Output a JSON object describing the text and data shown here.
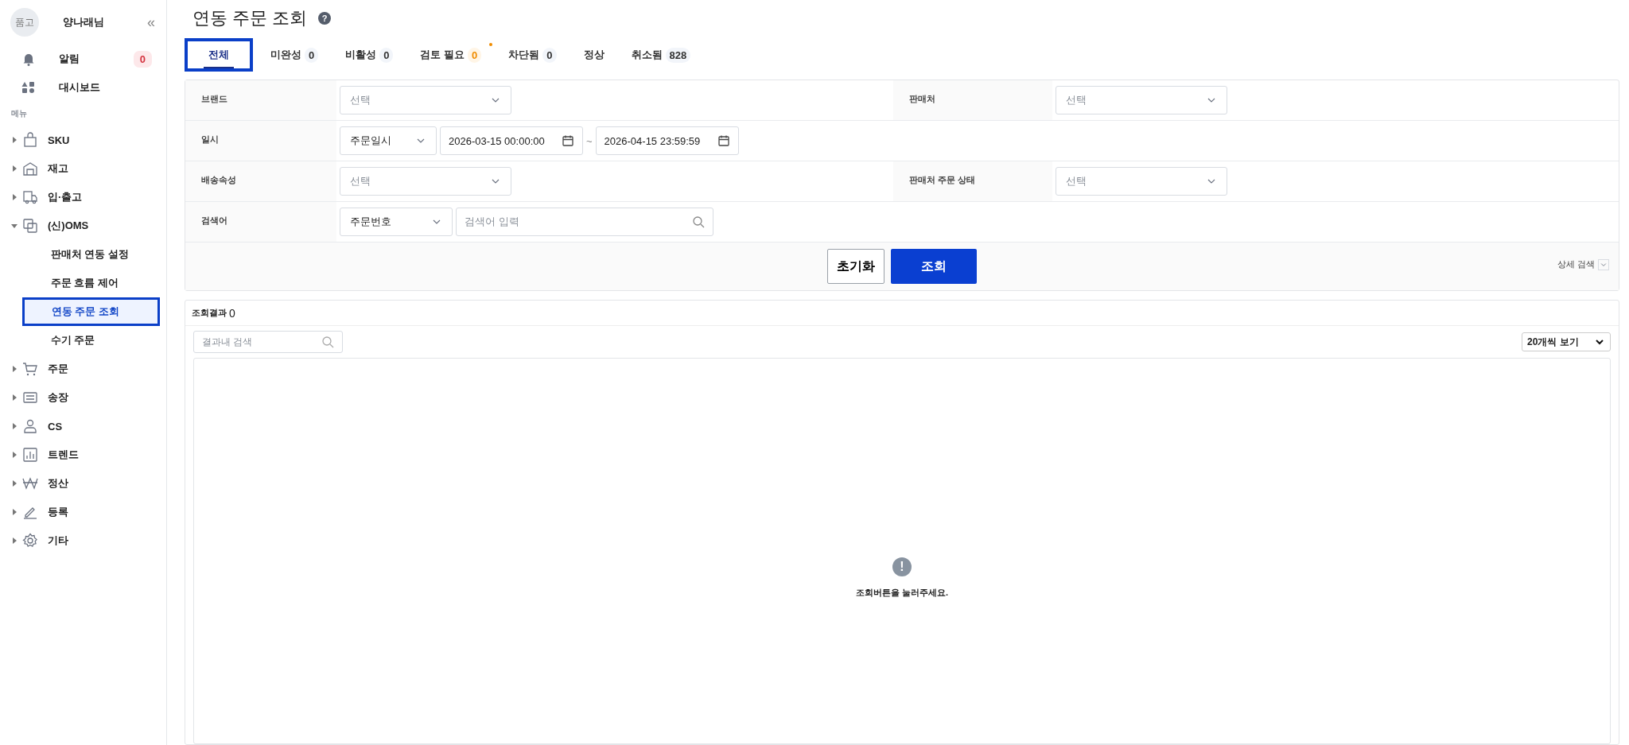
{
  "sidebar": {
    "avatar": "품고",
    "user_name": "양나래님",
    "collapse": "«",
    "top_items": [
      {
        "kind": "bell",
        "label": "알림",
        "badge": "0"
      },
      {
        "kind": "dashboard",
        "label": "대시보드"
      }
    ],
    "section_label": "메뉴",
    "items": [
      {
        "kind": "bag",
        "label": "SKU",
        "expanded": false
      },
      {
        "kind": "warehouse",
        "label": "재고",
        "expanded": false
      },
      {
        "kind": "truck",
        "label": "입·출고",
        "expanded": false
      },
      {
        "kind": "link",
        "label": "(신)OMS",
        "expanded": true,
        "children": [
          {
            "label": "판매처 연동 설정",
            "selected": false
          },
          {
            "label": "주문 흐름 제어",
            "selected": false
          },
          {
            "label": "연동 주문 조회",
            "selected": true
          },
          {
            "label": "수기 주문",
            "selected": false
          }
        ]
      },
      {
        "kind": "cart",
        "label": "주문",
        "expanded": false
      },
      {
        "kind": "invoice",
        "label": "송장",
        "expanded": false
      },
      {
        "kind": "person",
        "label": "CS",
        "expanded": false
      },
      {
        "kind": "chart",
        "label": "트렌드",
        "expanded": false
      },
      {
        "kind": "won",
        "label": "정산",
        "expanded": false
      },
      {
        "kind": "pen",
        "label": "등록",
        "expanded": false
      },
      {
        "kind": "gear",
        "label": "기타",
        "expanded": false
      }
    ]
  },
  "page": {
    "title": "연동 주문 조회",
    "help": "?"
  },
  "tabs": [
    {
      "label": "전체",
      "selected": true
    },
    {
      "label": "미완성",
      "count": "0",
      "alert": false,
      "selected": false
    },
    {
      "label": "비활성",
      "count": "0",
      "alert": false,
      "selected": false
    },
    {
      "label": "검토 필요",
      "count": "0",
      "alert": true,
      "selected": false
    },
    {
      "label": "차단됨",
      "count": "0",
      "alert": false,
      "selected": false
    },
    {
      "label": "정상",
      "selected": false
    },
    {
      "label": "취소됨",
      "count": "828",
      "alert": false,
      "selected": false
    }
  ],
  "filters": [
    {
      "label": "브랜드",
      "controls": [
        {
          "kind": "select",
          "placeholder": "선택"
        }
      ],
      "right": {
        "label": "판매처",
        "controls": [
          {
            "kind": "select",
            "placeholder": "선택"
          }
        ]
      }
    },
    {
      "label": "일시",
      "controls": [
        {
          "kind": "select",
          "value": "주문일시"
        },
        {
          "kind": "date",
          "value": "2026-03-15 00:00:00"
        },
        {
          "kind": "sep",
          "text": "~"
        },
        {
          "kind": "date",
          "value": "2026-04-15 23:59:59"
        }
      ]
    },
    {
      "label": "배송속성",
      "controls": [
        {
          "kind": "select",
          "placeholder": "선택"
        }
      ],
      "right": {
        "label": "판매처 주문 상태",
        "controls": [
          {
            "kind": "select",
            "placeholder": "선택"
          }
        ]
      }
    },
    {
      "label": "검색어",
      "controls": [
        {
          "kind": "select",
          "value": "주문번호"
        },
        {
          "kind": "search",
          "placeholder": "검색어 입력"
        }
      ]
    }
  ],
  "actions": {
    "reset": "초기화",
    "search": "조회",
    "detail": {
      "label": "상세 검색",
      "expanded": false
    }
  },
  "results": {
    "title": "조회결과",
    "count": "0",
    "search_placeholder": "결과내 검색",
    "page_size": "20개씩 보기",
    "empty_icon": "!",
    "empty_message": "조회버튼을 눌러주세요."
  }
}
